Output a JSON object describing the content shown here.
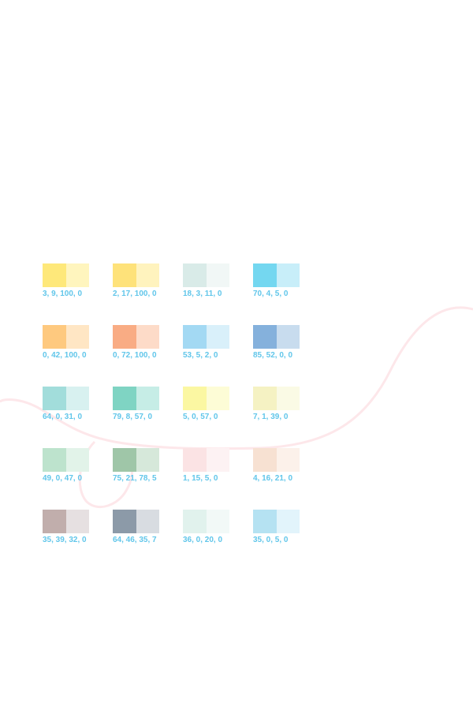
{
  "theme": {
    "label_color": "#61c6ea",
    "curve_color": "#fde7ea"
  },
  "swatches": [
    {
      "label": "3, 9, 100, 0",
      "solid": "#fee87a",
      "tint": "#fff5be"
    },
    {
      "label": "2, 17, 100, 0",
      "solid": "#fee27a",
      "tint": "#fff3be"
    },
    {
      "label": "18, 3, 11, 0",
      "solid": "#d9ebe8",
      "tint": "#f1f7f6"
    },
    {
      "label": "70, 4, 5, 0",
      "solid": "#74d7f0",
      "tint": "#c8eef9"
    },
    {
      "label": "0, 42, 100, 0",
      "solid": "#fec97f",
      "tint": "#ffe6c4"
    },
    {
      "label": "0, 72, 100, 0",
      "solid": "#f9ac84",
      "tint": "#fddbc8"
    },
    {
      "label": "53, 5, 2, 0",
      "solid": "#a3d9f3",
      "tint": "#d9f0fa"
    },
    {
      "label": "85, 52, 0, 0",
      "solid": "#85b1dc",
      "tint": "#c8dcee"
    },
    {
      "label": "64, 0, 31, 0",
      "solid": "#a2dddb",
      "tint": "#d8f1f0"
    },
    {
      "label": "79, 8, 57, 0",
      "solid": "#7fd4c3",
      "tint": "#c6ede6"
    },
    {
      "label": "5, 0, 57, 0",
      "solid": "#fbf7a2",
      "tint": "#fdfcd6"
    },
    {
      "label": "7, 1, 39, 0",
      "solid": "#f5f2c3",
      "tint": "#fafae5"
    },
    {
      "label": "49, 0, 47, 0",
      "solid": "#bde3cd",
      "tint": "#e2f3e9"
    },
    {
      "label": "75, 21, 78, 5",
      "solid": "#9fc6a8",
      "tint": "#d6e8da"
    },
    {
      "label": "1, 15, 5, 0",
      "solid": "#fbe3e4",
      "tint": "#fdf2f3"
    },
    {
      "label": "4, 16, 21, 0",
      "solid": "#f7e1d2",
      "tint": "#fcf1ea"
    },
    {
      "label": "35, 39, 32, 0",
      "solid": "#c1aeac",
      "tint": "#e6e0e1"
    },
    {
      "label": "64, 46, 35, 7",
      "solid": "#8c9aa8",
      "tint": "#d8dce1"
    },
    {
      "label": "36, 0, 20, 0",
      "solid": "#e1f2ed",
      "tint": "#f2f9f7"
    },
    {
      "label": "35, 0, 5, 0",
      "solid": "#b5e2f2",
      "tint": "#e2f4fb"
    }
  ]
}
